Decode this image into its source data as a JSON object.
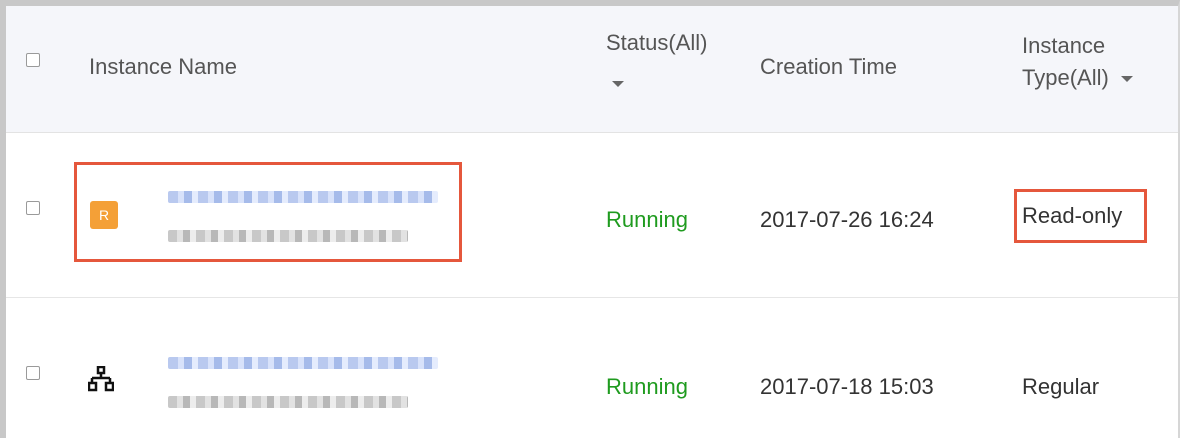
{
  "table": {
    "headers": {
      "instance_name": "Instance Name",
      "status": "Status(All)",
      "creation_time": "Creation Time",
      "instance_type_line1": "Instance",
      "instance_type_line2": "Type(All)"
    },
    "rows": [
      {
        "badge": "R",
        "status": "Running",
        "creation_time": "2017-07-26 16:24",
        "instance_type": "Read-only"
      },
      {
        "icon": "topology-icon",
        "status": "Running",
        "creation_time": "2017-07-18 15:03",
        "instance_type": "Regular"
      }
    ]
  },
  "colors": {
    "running": "#1f9b1f",
    "highlight": "#e5573c",
    "readonly_badge": "#f4a037"
  }
}
